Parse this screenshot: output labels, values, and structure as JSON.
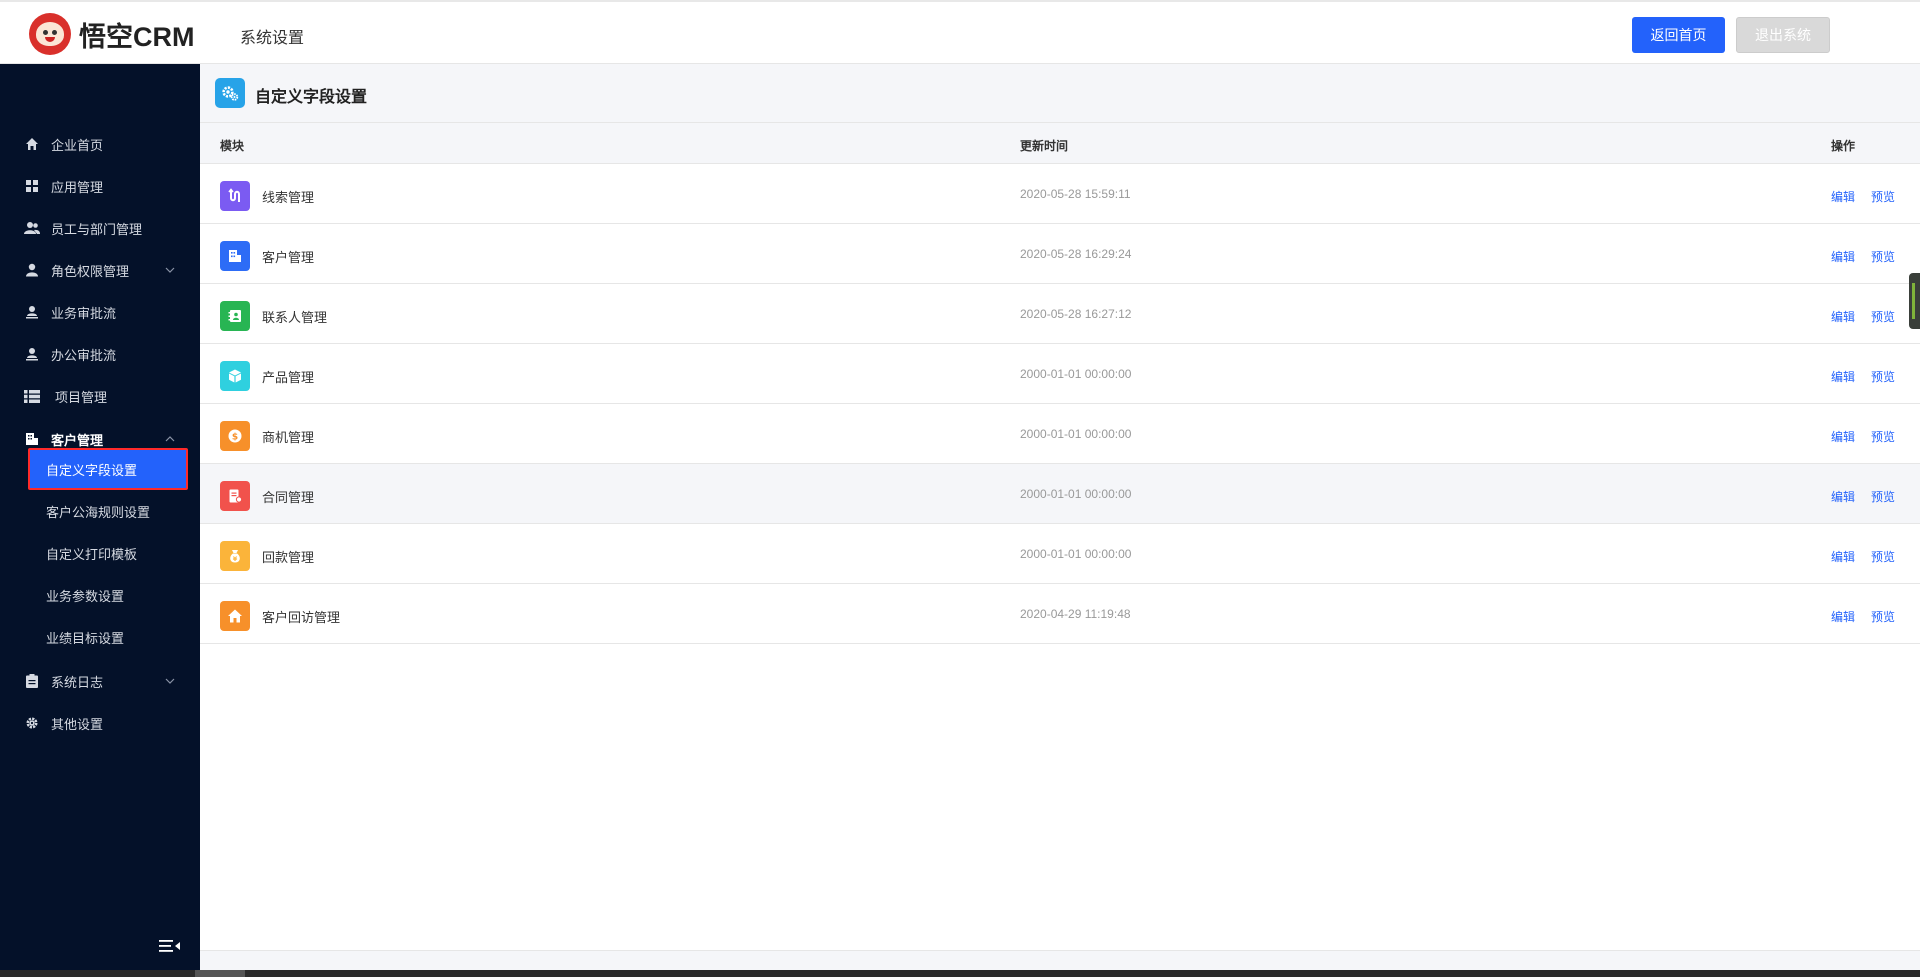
{
  "header": {
    "logo_text": "悟空CRM",
    "title": "系统设置",
    "home_button": "返回首页",
    "exit_button": "退出系统"
  },
  "sidebar": {
    "items": [
      {
        "label": "企业首页",
        "icon": "home-icon"
      },
      {
        "label": "应用管理",
        "icon": "grid-icon"
      },
      {
        "label": "员工与部门管理",
        "icon": "users-icon"
      },
      {
        "label": "角色权限管理",
        "icon": "user-icon",
        "expandable": true
      },
      {
        "label": "业务审批流",
        "icon": "approval-icon"
      },
      {
        "label": "办公审批流",
        "icon": "approval-icon"
      },
      {
        "label": "项目管理",
        "icon": "list-icon"
      },
      {
        "label": "客户管理",
        "icon": "building-icon",
        "expanded": true
      },
      {
        "label": "系统日志",
        "icon": "clipboard-icon",
        "expandable": true
      },
      {
        "label": "其他设置",
        "icon": "gear-icon"
      }
    ],
    "sub_items": [
      {
        "label": "自定义字段设置",
        "selected": true
      },
      {
        "label": "客户公海规则设置"
      },
      {
        "label": "自定义打印模板"
      },
      {
        "label": "业务参数设置"
      },
      {
        "label": "业绩目标设置"
      }
    ]
  },
  "page": {
    "title": "自定义字段设置",
    "columns": {
      "module": "模块",
      "time": "更新时间",
      "op": "操作"
    },
    "edit_label": "编辑",
    "preview_label": "预览",
    "rows": [
      {
        "name": "线索管理",
        "time": "2020-05-28 15:59:11",
        "color": "#7b5bf2",
        "icon": "leads-icon"
      },
      {
        "name": "客户管理",
        "time": "2020-05-28 16:29:24",
        "color": "#2d6cf6",
        "icon": "customer-icon"
      },
      {
        "name": "联系人管理",
        "time": "2020-05-28 16:27:12",
        "color": "#28b553",
        "icon": "contact-icon"
      },
      {
        "name": "产品管理",
        "time": "2000-01-01 00:00:00",
        "color": "#2fd0df",
        "icon": "product-icon"
      },
      {
        "name": "商机管理",
        "time": "2000-01-01 00:00:00",
        "color": "#f7902a",
        "icon": "opportunity-icon"
      },
      {
        "name": "合同管理",
        "time": "2000-01-01 00:00:00",
        "color": "#f1524c",
        "icon": "contract-icon"
      },
      {
        "name": "回款管理",
        "time": "2000-01-01 00:00:00",
        "color": "#fbb43a",
        "icon": "payment-icon"
      },
      {
        "name": "客户回访管理",
        "time": "2020-04-29 11:19:48",
        "color": "#f7902a",
        "icon": "visit-icon"
      }
    ]
  },
  "colors": {
    "primary": "#2362fb",
    "sidebar_bg": "#041129",
    "selection_outline": "#ff2a2a"
  }
}
